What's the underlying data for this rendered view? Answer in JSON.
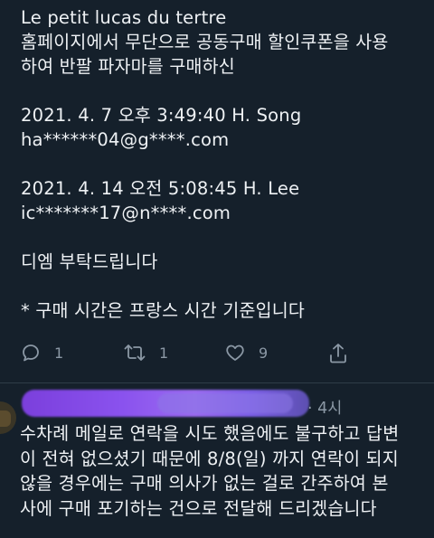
{
  "tweet": {
    "lines": [
      "Le petit lucas du tertre",
      "홈페이지에서 무단으로 공동구매 할인쿠폰을 사용",
      "하여 반팔 파자마를 구매하신",
      "",
      "2021. 4. 7 오후 3:49:40 H. Song",
      "ha******04@g****.com",
      "",
      "2021. 4. 14 오전 5:08:45 H. Lee",
      "ic*******17@n****.com",
      "",
      "디엠 부탁드립니다",
      "",
      "* 구매 시간은 프랑스 시간 기준입니다"
    ],
    "actions": {
      "reply_icon": "reply-icon",
      "reply_count": "1",
      "retweet_icon": "retweet-icon",
      "retweet_count": "1",
      "like_icon": "heart-icon",
      "like_count": "9",
      "share_icon": "share-icon"
    }
  },
  "reply": {
    "time": "· 4시",
    "lines": [
      "수차례 메일로 연락을 시도 했음에도 불구하고 답변",
      "이 전혀 없으셨기 때문에 8/8(일) 까지 연락이 되지",
      "않을 경우에는 구매 의사가 없는 걸로 간주하여 본",
      "사에 구매 포기하는 건으로 전달해 드리겠습니다"
    ]
  },
  "colors": {
    "background": "#15202b",
    "text": "#eef1f4",
    "muted": "#8b98a5",
    "redaction": "#8a52ee"
  }
}
